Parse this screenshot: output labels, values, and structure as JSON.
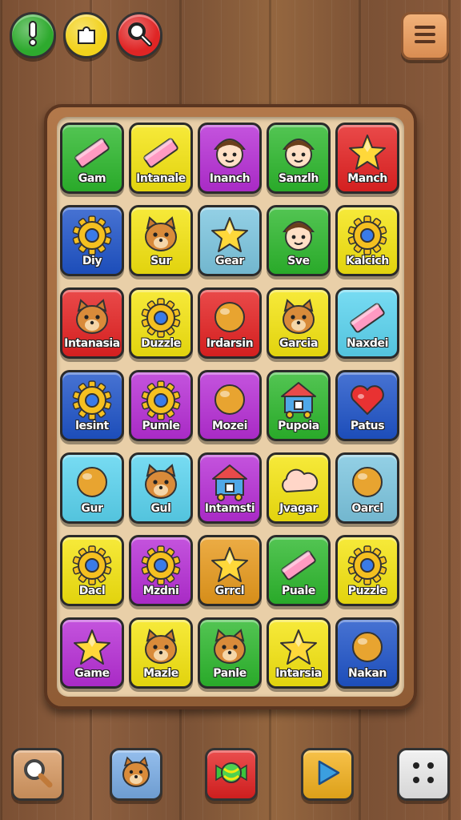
{
  "top_bar": {
    "buttons": [
      {
        "icon": "exclamation-icon",
        "color": "#2eaa2e"
      },
      {
        "icon": "puzzle-piece-icon",
        "color": "#f2d21c"
      },
      {
        "icon": "search-icon",
        "color": "#e02525"
      }
    ],
    "menu": {
      "icon": "hamburger-menu-icon",
      "color": "#e8a468"
    }
  },
  "tiles": [
    {
      "label": "Gam",
      "color": "#2db82d",
      "icon": "bar"
    },
    {
      "label": "Intanale",
      "color": "#f5e50f",
      "icon": "bar"
    },
    {
      "label": "Inanch",
      "color": "#b72ed6",
      "icon": "face"
    },
    {
      "label": "Sanzlh",
      "color": "#2db82d",
      "icon": "face"
    },
    {
      "label": "Manch",
      "color": "#e52222",
      "icon": "star"
    },
    {
      "label": "Diy",
      "color": "#1f54c9",
      "icon": "gear"
    },
    {
      "label": "Sur",
      "color": "#f5e50f",
      "icon": "animal"
    },
    {
      "label": "Gear",
      "color": "#7cc6e0",
      "icon": "star"
    },
    {
      "label": "Sve",
      "color": "#2db82d",
      "icon": "face"
    },
    {
      "label": "Kalcich",
      "color": "#f5e50f",
      "icon": "gear"
    },
    {
      "label": "Intanasia",
      "color": "#e52222",
      "icon": "animal"
    },
    {
      "label": "Duzzle",
      "color": "#f5e50f",
      "icon": "gear"
    },
    {
      "label": "Irdarsin",
      "color": "#e52222",
      "icon": "ball"
    },
    {
      "label": "Garcia",
      "color": "#f5e50f",
      "icon": "animal"
    },
    {
      "label": "Naxdei",
      "color": "#5ad4f0",
      "icon": "bar"
    },
    {
      "label": "lesint",
      "color": "#1f54c9",
      "icon": "gear"
    },
    {
      "label": "Pumle",
      "color": "#b72ed6",
      "icon": "gear"
    },
    {
      "label": "Mozei",
      "color": "#b72ed6",
      "icon": "ball"
    },
    {
      "label": "Pupoia",
      "color": "#2db82d",
      "icon": "house"
    },
    {
      "label": "Patus",
      "color": "#1f54c9",
      "icon": "heart"
    },
    {
      "label": "Gur",
      "color": "#5ad4f0",
      "icon": "ball"
    },
    {
      "label": "Gul",
      "color": "#5ad4f0",
      "icon": "animal"
    },
    {
      "label": "Intamsti",
      "color": "#b72ed6",
      "icon": "house"
    },
    {
      "label": "Jvagar",
      "color": "#f5e50f",
      "icon": "cloud"
    },
    {
      "label": "Oarcl",
      "color": "#7cc6e0",
      "icon": "ball"
    },
    {
      "label": "Dacl",
      "color": "#f5e50f",
      "icon": "gear"
    },
    {
      "label": "Mzdni",
      "color": "#b72ed6",
      "icon": "gear"
    },
    {
      "label": "Grrcl",
      "color": "#e89a1c",
      "icon": "star"
    },
    {
      "label": "Puale",
      "color": "#2db82d",
      "icon": "bar"
    },
    {
      "label": "Puzzle",
      "color": "#f5e50f",
      "icon": "gear"
    },
    {
      "label": "Game",
      "color": "#b72ed6",
      "icon": "star"
    },
    {
      "label": "Mazle",
      "color": "#f5e50f",
      "icon": "animal"
    },
    {
      "label": "Panle",
      "color": "#2db82d",
      "icon": "animal"
    },
    {
      "label": "Intarsia",
      "color": "#f5e50f",
      "icon": "star"
    },
    {
      "label": "Nakan",
      "color": "#1f54c9",
      "icon": "ball"
    }
  ],
  "bottom_bar": [
    {
      "icon": "magnifier-icon",
      "color": "#d99a62"
    },
    {
      "icon": "animal-face-icon",
      "color": "#7aaee8"
    },
    {
      "icon": "candy-icon",
      "color": "#e52222"
    },
    {
      "icon": "play-icon",
      "color": "#f5b21c"
    },
    {
      "icon": "dice-icon",
      "color": "#eeeeee"
    }
  ]
}
